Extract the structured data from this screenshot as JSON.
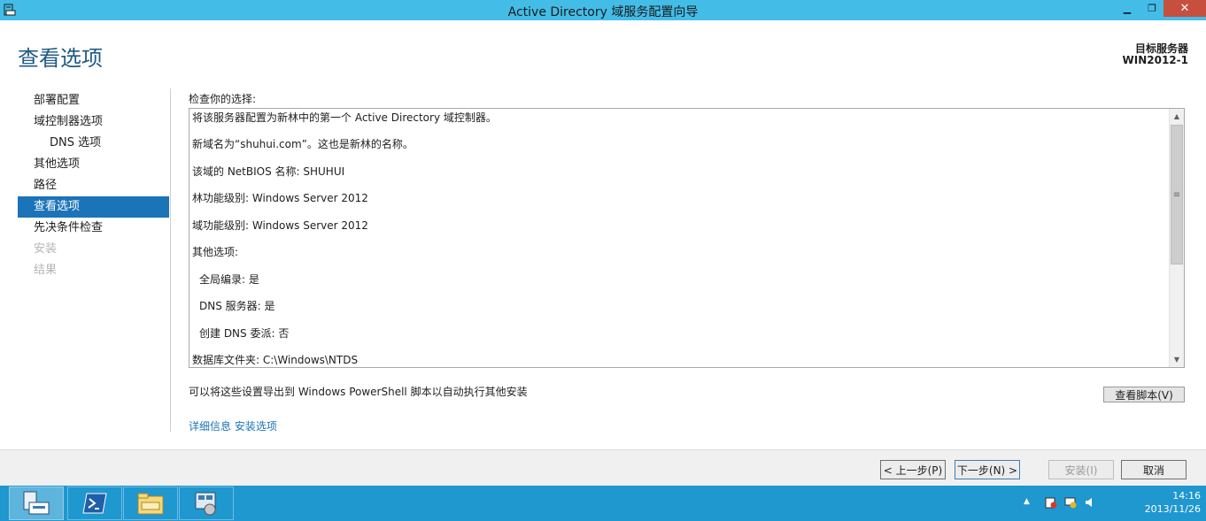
{
  "window": {
    "title": "Active Directory 域服务配置向导",
    "min_glyph": "▁",
    "max_glyph": "❐",
    "close_glyph": "✕"
  },
  "header": {
    "page_title": "查看选项",
    "target_label": "目标服务器",
    "target_name": "WIN2012-1"
  },
  "nav": {
    "items": [
      {
        "label": "部署配置",
        "state": "normal"
      },
      {
        "label": "域控制器选项",
        "state": "normal"
      },
      {
        "label": "DNS 选项",
        "state": "sub"
      },
      {
        "label": "其他选项",
        "state": "normal"
      },
      {
        "label": "路径",
        "state": "normal"
      },
      {
        "label": "查看选项",
        "state": "active"
      },
      {
        "label": "先决条件检查",
        "state": "normal"
      },
      {
        "label": "安装",
        "state": "disabled"
      },
      {
        "label": "结果",
        "state": "disabled"
      }
    ]
  },
  "main": {
    "check_label": "检查你的选择:",
    "review_lines": [
      {
        "text": "将该服务器配置为新林中的第一个 Active Directory 域控制器。",
        "indent": false
      },
      {
        "text": "新域名为“shuhui.com”。这也是新林的名称。",
        "indent": false
      },
      {
        "text": "该域的 NetBIOS 名称: SHUHUI",
        "indent": false
      },
      {
        "text": "林功能级别: Windows Server 2012",
        "indent": false
      },
      {
        "text": "域功能级别: Windows Server 2012",
        "indent": false
      },
      {
        "text": "其他选项:",
        "indent": false
      },
      {
        "text": "全局编录: 是",
        "indent": true
      },
      {
        "text": "DNS 服务器: 是",
        "indent": true
      },
      {
        "text": "创建 DNS 委派: 否",
        "indent": true
      },
      {
        "text": "数据库文件夹: C:\\Windows\\NTDS",
        "indent": false
      }
    ],
    "export_text": "可以将这些设置导出到 Windows PowerShell 脚本以自动执行其他安装",
    "view_script_label": "查看脚本(V)",
    "more_info_prefix": "详细信息",
    "more_info_link": "安装选项"
  },
  "footer": {
    "prev_label": "< 上一步(P)",
    "next_label": "下一步(N) >",
    "install_label": "安装(I)",
    "cancel_label": "取消"
  },
  "taskbar": {
    "time": "14:16",
    "date": "2013/11/26"
  },
  "colors": {
    "titlebar": "#43bde8",
    "accent": "#1b73b8",
    "taskbar": "#1f97cf"
  }
}
